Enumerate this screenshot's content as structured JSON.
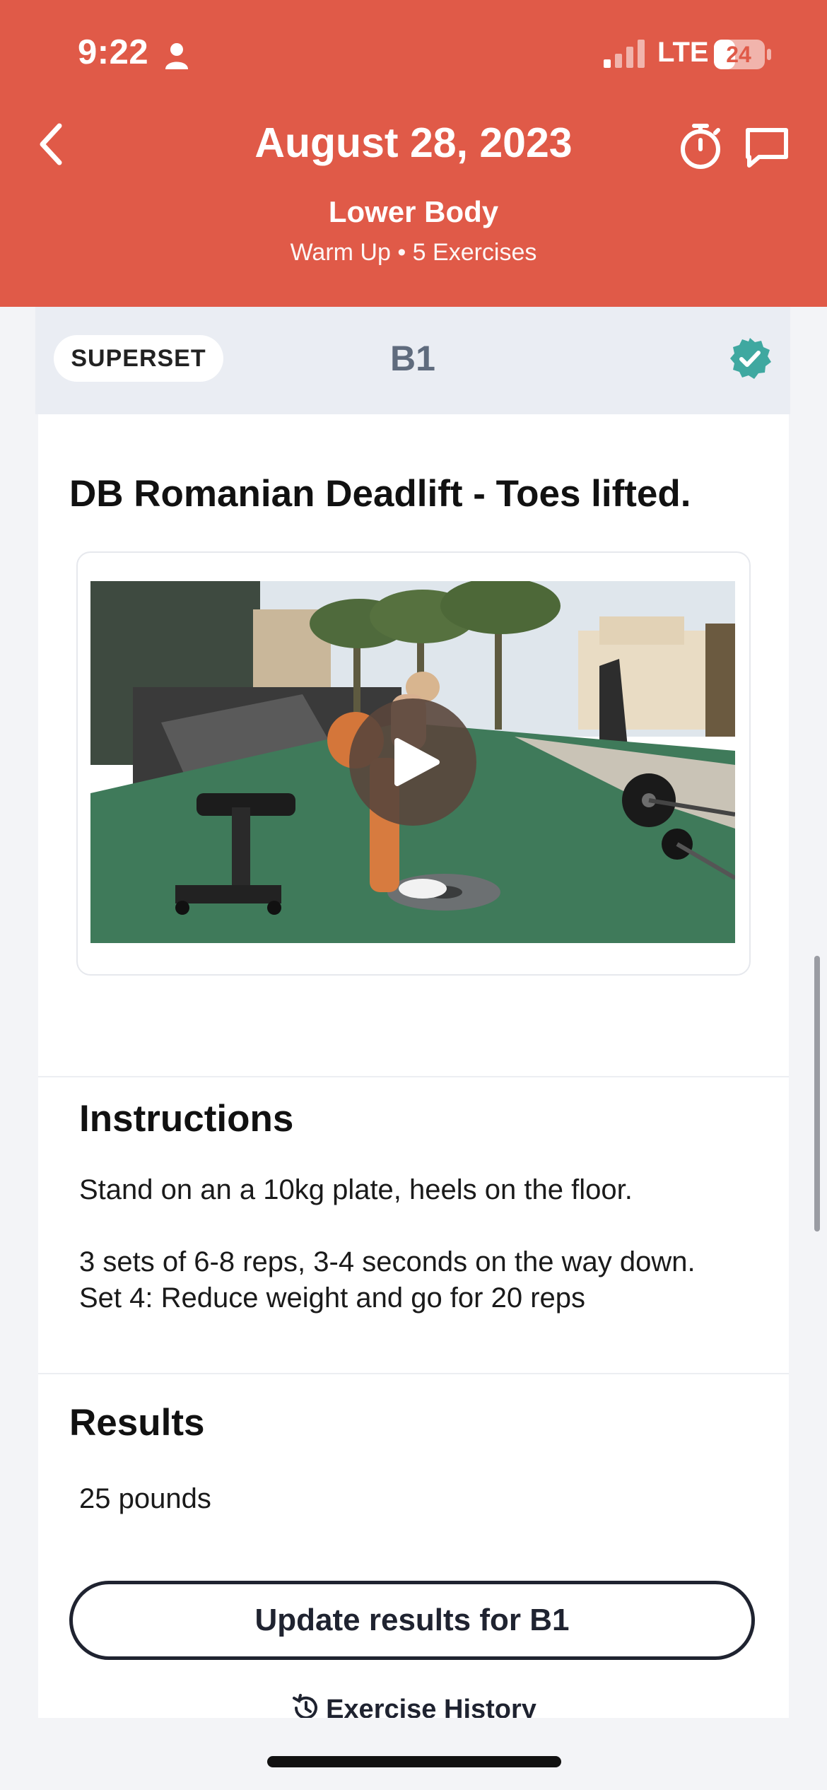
{
  "status_bar": {
    "time": "9:22",
    "network": "LTE",
    "battery": "24"
  },
  "header": {
    "title": "August 28, 2023",
    "workout_name": "Lower Body",
    "workout_meta": "Warm Up • 5 Exercises"
  },
  "superset": {
    "label": "SUPERSET",
    "code": "B1",
    "completed": true
  },
  "exercise": {
    "title": "DB Romanian Deadlift - Toes lifted.",
    "instructions_heading": "Instructions",
    "instructions": [
      "Stand on an a 10kg plate, heels on the floor.",
      "",
      "3 sets of 6-8 reps, 3-4 seconds on the way down.",
      "Set 4: Reduce weight and go for 20 reps"
    ],
    "results_heading": "Results",
    "results_value": "25 pounds",
    "update_button": "Update results for B1",
    "history_link": "Exercise History"
  },
  "colors": {
    "header_bg": "#e05a48",
    "check_green": "#3fa8a0"
  }
}
